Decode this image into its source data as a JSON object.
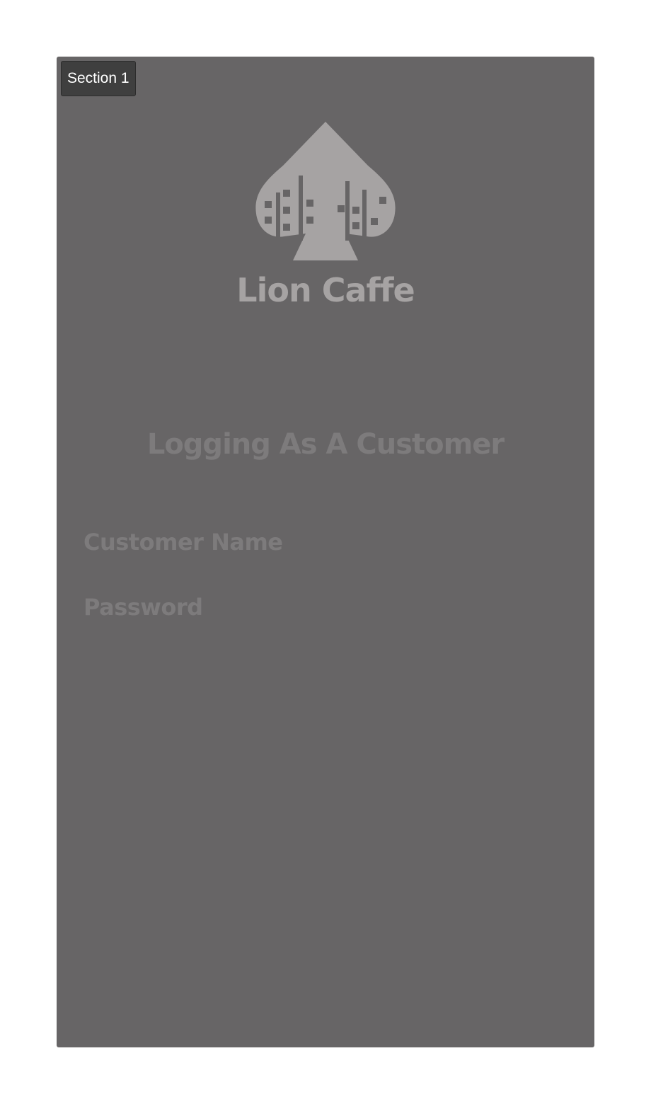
{
  "section_label": "Section 1",
  "brand": {
    "name": "Lion Caffe",
    "logo_icon": "spade-city-skyline-icon"
  },
  "login": {
    "title": "Logging As A Customer",
    "customer_name_label": "Customer Name",
    "password_label": "Password"
  },
  "colors": {
    "frame_background": "#676566",
    "logo": "#a6a3a3",
    "muted_text": "#7d7b7c",
    "section_tag": "#3f3f3f"
  }
}
